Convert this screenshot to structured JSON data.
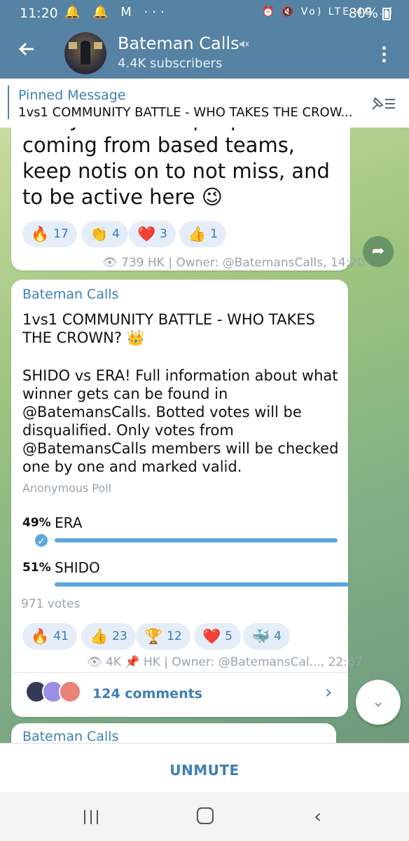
{
  "status_bar": {
    "time": "11:20",
    "notifications": "🔔 🔔 M ···",
    "system_icons": "⏰ 🔇 Vo) LTE 4G .ıl",
    "battery": "80%"
  },
  "header": {
    "title": "Bateman Calls",
    "subtitle": "4.4K subscribers",
    "back_icon": "arrow-left-icon",
    "mute_icon": "speaker-muted-icon",
    "menu_icon": "kebab-icon"
  },
  "pinned": {
    "label": "Pinned Message",
    "text": "1vs1 COMMUNITY BATTLE - WHO TAKES THE CROW..."
  },
  "message1": {
    "text": "Today I have couple posts coming from based teams, keep notis on to not miss, and to be active here 😉",
    "reactions": [
      {
        "emoji": "🔥",
        "count": "17"
      },
      {
        "emoji": "👏",
        "count": "4"
      },
      {
        "emoji": "❤️",
        "count": "3"
      },
      {
        "emoji": "👍",
        "count": "1"
      }
    ],
    "views": "739",
    "signature": "HK | Owner: @BatemansCalls, 14:20"
  },
  "poll_message": {
    "sender": "Bateman Calls",
    "question": "1vs1 COMMUNITY BATTLE - WHO TAKES THE CROWN? 👑",
    "body": "SHIDO vs ERA! Full information about what winner gets can be found in @BatemansCalls. Botted votes will be disqualified. Only votes from @BatemansCalls members will be checked one by one and marked valid.",
    "poll_type": "Anonymous Poll",
    "options": [
      {
        "percent": "49%",
        "label": "ERA",
        "fraction": 0.49,
        "selected": true
      },
      {
        "percent": "51%",
        "label": "SHIDO",
        "fraction": 0.51,
        "selected": false
      }
    ],
    "votes": "971 votes",
    "reactions": [
      {
        "emoji": "🔥",
        "count": "41"
      },
      {
        "emoji": "👍",
        "count": "23"
      },
      {
        "emoji": "🏆",
        "count": "12"
      },
      {
        "emoji": "❤️",
        "count": "5"
      },
      {
        "emoji": "🐳",
        "count": "4"
      }
    ],
    "views": "4K",
    "signature": "HK | Owner: @BatemansCal..., 22:07",
    "comments": "124 comments"
  },
  "message3": {
    "sender": "Bateman Calls"
  },
  "bottom": {
    "unmute": "UNMUTE"
  },
  "colors": {
    "header": "#5682a3",
    "accent": "#3f7fb5",
    "poll_bar": "#5fa6dd",
    "reaction_bg": "#e5eef8"
  }
}
